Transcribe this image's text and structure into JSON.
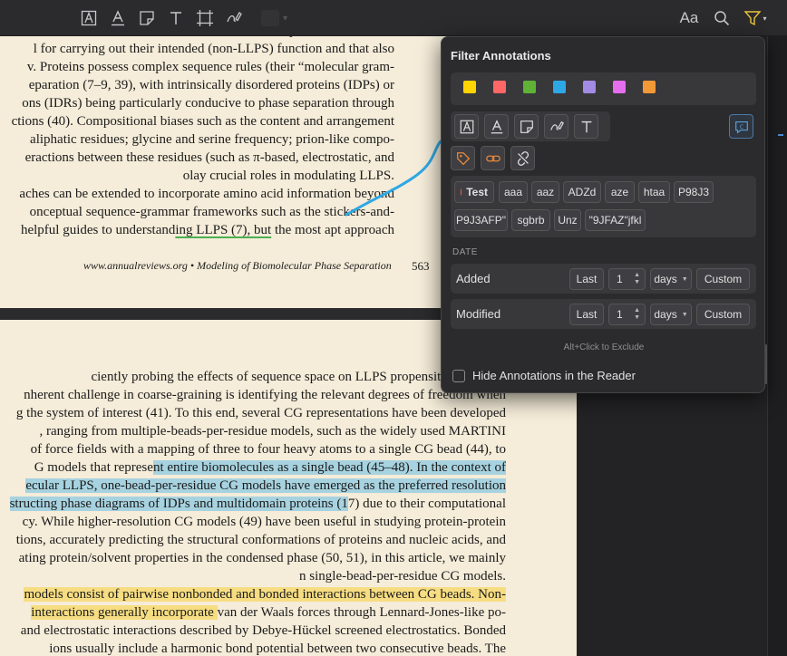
{
  "toolbar": {
    "left_tools": [
      {
        "icon": "highlight-text-icon"
      },
      {
        "icon": "underline-text-icon"
      },
      {
        "icon": "note-icon"
      },
      {
        "icon": "text-icon"
      },
      {
        "icon": "area-select-icon"
      },
      {
        "icon": "ink-icon"
      }
    ],
    "right_tools": [
      {
        "icon": "appearance-icon",
        "label": "Aa"
      },
      {
        "icon": "search-icon"
      },
      {
        "icon": "filter-icon"
      }
    ]
  },
  "document": {
    "page1_lines": [
      {
        "t": "proteins are recruited into condensates because of their many other interactions"
      },
      {
        "t": "l for carrying out their intended (non-LLPS) function and that also"
      },
      {
        "t": "v. Proteins possess complex sequence rules (their “molecular gram-"
      },
      {
        "t": "eparation (7–9, 39), with intrinsically disordered proteins (IDPs) or"
      },
      {
        "t": "ons (IDRs) being particularly conducive to phase separation through"
      },
      {
        "t": "ctions (40). Compositional biases such as the content and arrangement"
      },
      {
        "t": "aliphatic residues; glycine and serine frequency; prion-like compo-"
      },
      {
        "t": "eractions between these residues (such as π-based, electrostatic, and"
      },
      {
        "t": "olay crucial roles in modulating LLPS."
      },
      {
        "t": "aches can be extended to incorporate amino acid information beyond"
      },
      {
        "t": "onceptual sequence-grammar frameworks such as the stickers-and-"
      },
      {
        "pre": "helpful guides to understand",
        "ul": "ing LLPS (7), but",
        "post": " the most apt approach"
      }
    ],
    "footer": "www.annualreviews.org  •  Modeling of Biomolecular Phase Separation",
    "page_number": "563",
    "page2_lines": [
      {
        "t": "ciently probing the effects of sequence space on LLPS propensity is through"
      },
      {
        "t": "nherent challenge in coarse-graining is identifying the relevant degrees of freedom when"
      },
      {
        "t": "g the system of interest (41). To this end, several CG representations have been developed"
      },
      {
        "t": ", ranging from multiple-beads-per-residue models, such as the widely used MARTINI"
      },
      {
        "t": "of force fields with a mapping of three to four heavy atoms to a single CG bead (44), to"
      },
      {
        "pre": "G models that represe",
        "hl": "nt entire biomolecules as a single bead (45–48). In the context of",
        "hlc": "blue"
      },
      {
        "hl": "ecular LLPS, one-bead-per-residue CG models have emerged as the preferred resolution",
        "hlc": "blue"
      },
      {
        "hl": "structing phase diagrams of IDPs and multidomain proteins (1",
        "hlc": "blue",
        "post": "7) due to their computational"
      },
      {
        "t": "cy. While higher-resolution CG models (49) have been useful in studying protein-protein"
      },
      {
        "t": "tions, accurately predicting the structural conformations of proteins and nucleic acids, and"
      },
      {
        "t": "ating protein/solvent properties in the condensed phase (50, 51), in this article, we mainly"
      },
      {
        "t": "n single-bead-per-residue CG models."
      },
      {
        "hl": "models consist of pairwise nonbonded and bonded interactions between CG beads. Non-",
        "hlc": "yellow"
      },
      {
        "hl": " interactions generally incorporate ",
        "hlc": "yellow",
        "post": "van der Waals forces through Lennard-Jones-like po-"
      },
      {
        "t": "and electrostatic interactions described by Debye-Hückel screened electrostatics. Bonded"
      },
      {
        "t": "ions usually include a harmonic bond potential between two consecutive beads. The"
      }
    ]
  },
  "filter": {
    "title": "Filter Annotations",
    "colors": [
      "#ffd400",
      "#ff6666",
      "#5fb236",
      "#2ea8e5",
      "#a28ae5",
      "#e56eee",
      "#f19837"
    ],
    "types": [
      {
        "icon": "highlight-text-icon"
      },
      {
        "icon": "underline-text-icon"
      },
      {
        "icon": "note-icon"
      },
      {
        "icon": "ink-icon"
      },
      {
        "icon": "text-icon"
      }
    ],
    "type_extra": {
      "icon": "comment-icon"
    },
    "misc_buttons": [
      {
        "icon": "tag-icon",
        "color": "#e8883a"
      },
      {
        "icon": "link-icon",
        "color": "#e8883a"
      },
      {
        "icon": "unlink-icon",
        "color": "#e0e0e0"
      }
    ],
    "tags": [
      {
        "label": "Test",
        "dot": "#ef5a5a"
      },
      {
        "label": "aaa"
      },
      {
        "label": "aaz"
      },
      {
        "label": "ADZd"
      },
      {
        "label": "aze"
      },
      {
        "label": "htaa"
      },
      {
        "label": "P98J3"
      },
      {
        "label": "P9J3AFP\""
      },
      {
        "label": "sgbrb"
      },
      {
        "label": "Unz"
      },
      {
        "label": "\"9JFAZ\"jfkl"
      }
    ],
    "date_label": "DATE",
    "added": {
      "label": "Added",
      "last": "Last",
      "value": "1",
      "unit": "days",
      "custom": "Custom"
    },
    "modified": {
      "label": "Modified",
      "last": "Last",
      "value": "1",
      "unit": "days",
      "custom": "Custom"
    },
    "hint": "Alt+Click to Exclude",
    "hide_label": "Hide Annotations in the Reader",
    "hide_checked": false
  }
}
